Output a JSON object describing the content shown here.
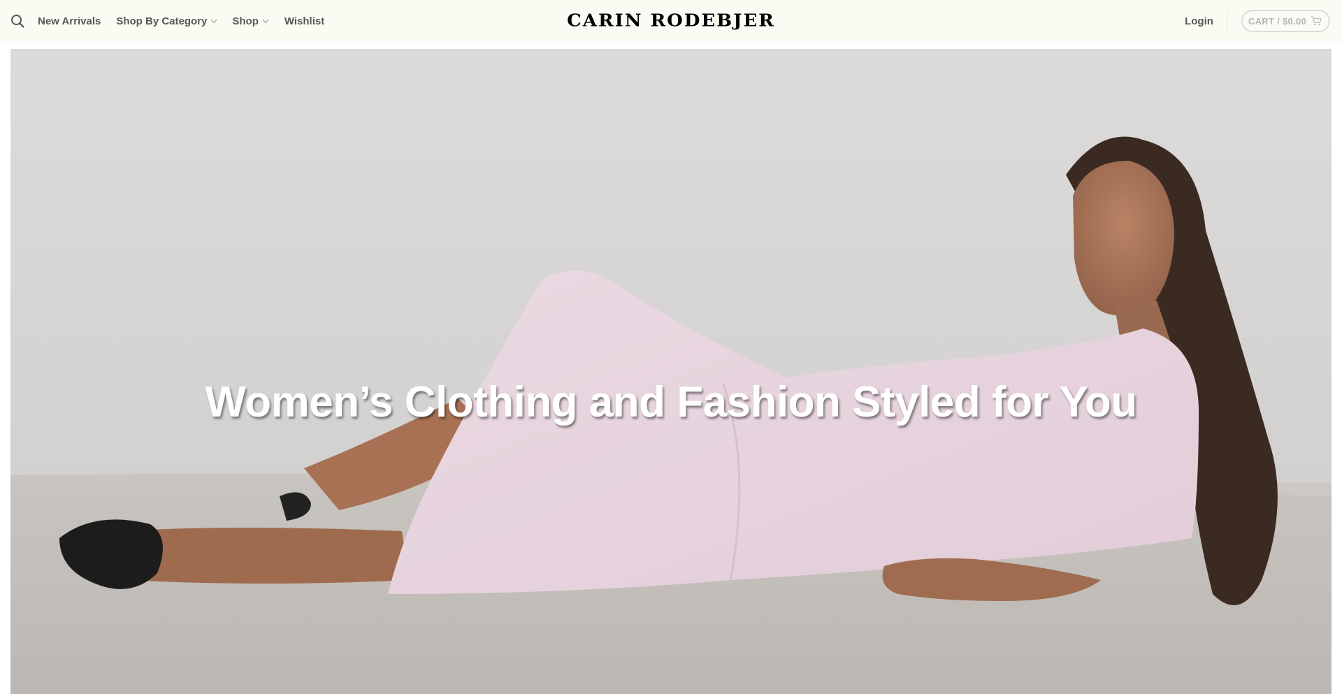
{
  "header": {
    "nav": [
      {
        "label": "New Arrivals",
        "has_dropdown": false
      },
      {
        "label": "Shop By Category",
        "has_dropdown": true
      },
      {
        "label": "Shop",
        "has_dropdown": true
      },
      {
        "label": "Wishlist",
        "has_dropdown": false
      }
    ],
    "logo_text": "CARIN RODEBJER",
    "login_label": "Login",
    "cart_label": "CART / $0.00",
    "icons": {
      "search": "search-icon",
      "cart": "cart-icon",
      "chevron": "chevron-down-icon"
    }
  },
  "hero": {
    "title": "Women’s Clothing and Fashion Styled for You"
  },
  "colors": {
    "header_bg": "#fcfbf3",
    "nav_text": "#575757",
    "logo_text": "#000000",
    "cart_text": "#b4b4b4",
    "hero_title": "#ffffff"
  }
}
